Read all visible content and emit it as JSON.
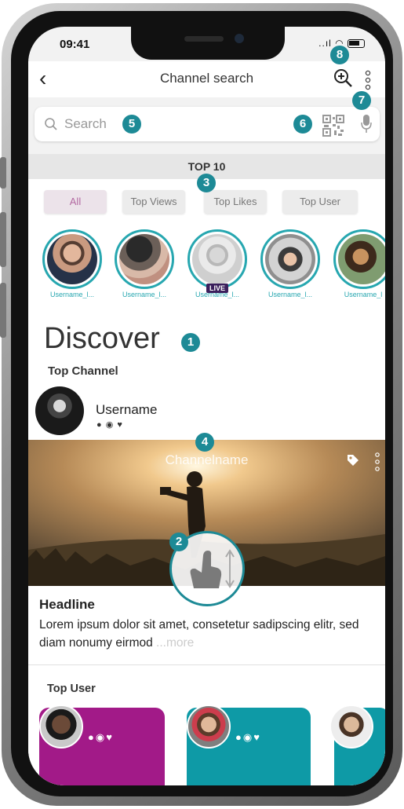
{
  "status_bar": {
    "time": "09:41",
    "signal": "..ıl"
  },
  "nav": {
    "back_label": "‹",
    "title": "Channel search"
  },
  "search": {
    "placeholder": "Search"
  },
  "section_label": "TOP 10",
  "filters": [
    {
      "label": "All",
      "selected": true
    },
    {
      "label": "Top Views",
      "selected": false
    },
    {
      "label": "Top Likes",
      "selected": false
    },
    {
      "label": "Top User",
      "selected": false
    }
  ],
  "stories": [
    {
      "username": "Username_l..."
    },
    {
      "username": "Username_l..."
    },
    {
      "username": "Username_l...",
      "live": "LIVE"
    },
    {
      "username": "Username_l..."
    },
    {
      "username": "Username_l"
    }
  ],
  "discover_title": "Discover",
  "top_channel": {
    "label": "Top Channel",
    "username": "Username",
    "channel_name": "Channelname",
    "headline": "Headline",
    "body": "Lorem ipsum dolor sit amet, consetetur sadipscing elitr, sed diam nonumy eirmod",
    "more": "...more"
  },
  "top_user": {
    "label": "Top User"
  },
  "markers": [
    "1",
    "2",
    "3",
    "4",
    "5",
    "6",
    "7",
    "8"
  ],
  "colors": {
    "accent": "#27a7b0",
    "marker": "#1d8a96",
    "magenta": "#a21a88",
    "teal": "#0e9aa6",
    "chip_selected": "#b36aa2"
  }
}
